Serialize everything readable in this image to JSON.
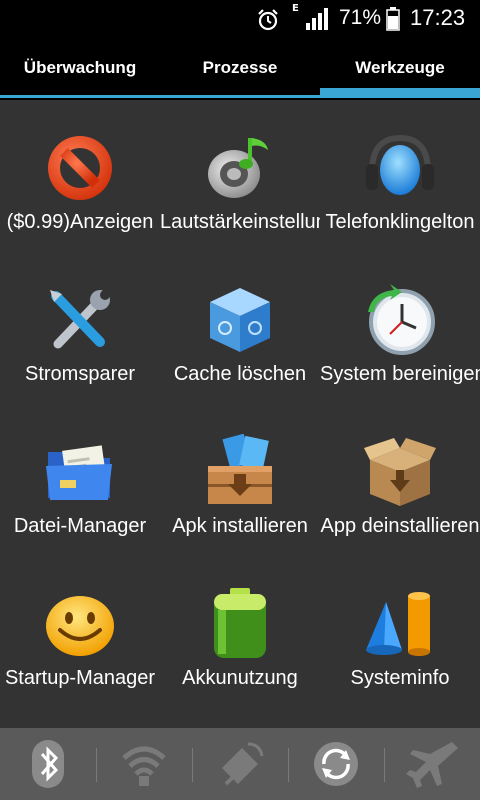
{
  "status": {
    "network_type": "E",
    "battery_percent": "71%",
    "time": "17:23",
    "icons": [
      "alarm-icon",
      "signal-icon",
      "battery-icon"
    ]
  },
  "tabs": [
    {
      "label": "Überwachung",
      "active": false
    },
    {
      "label": "Prozesse",
      "active": false
    },
    {
      "label": "Werkzeuge",
      "active": true
    }
  ],
  "accent_color": "#3aa6d6",
  "tools": [
    {
      "label": "($0.99)Anzeigen",
      "icon": "no-ads-icon"
    },
    {
      "label": "Lautstärkeinstellungen",
      "icon": "volume-icon"
    },
    {
      "label": "Telefonklingelton",
      "icon": "headphones-icon"
    },
    {
      "label": "Stromsparer",
      "icon": "tools-icon"
    },
    {
      "label": "Cache löschen",
      "icon": "cache-box-icon"
    },
    {
      "label": "System bereinigen",
      "icon": "clock-icon"
    },
    {
      "label": "Datei-Manager",
      "icon": "folder-icon"
    },
    {
      "label": "Apk installieren",
      "icon": "apk-install-icon"
    },
    {
      "label": "App deinstallieren",
      "icon": "open-box-icon"
    },
    {
      "label": "Startup-Manager",
      "icon": "smiley-icon"
    },
    {
      "label": "Akkunutzung",
      "icon": "battery-usage-icon"
    },
    {
      "label": "Systeminfo",
      "icon": "shapes-icon"
    }
  ],
  "quick_toggles": [
    "bluetooth-icon",
    "wifi-icon",
    "gps-icon",
    "sync-icon",
    "airplane-icon"
  ]
}
